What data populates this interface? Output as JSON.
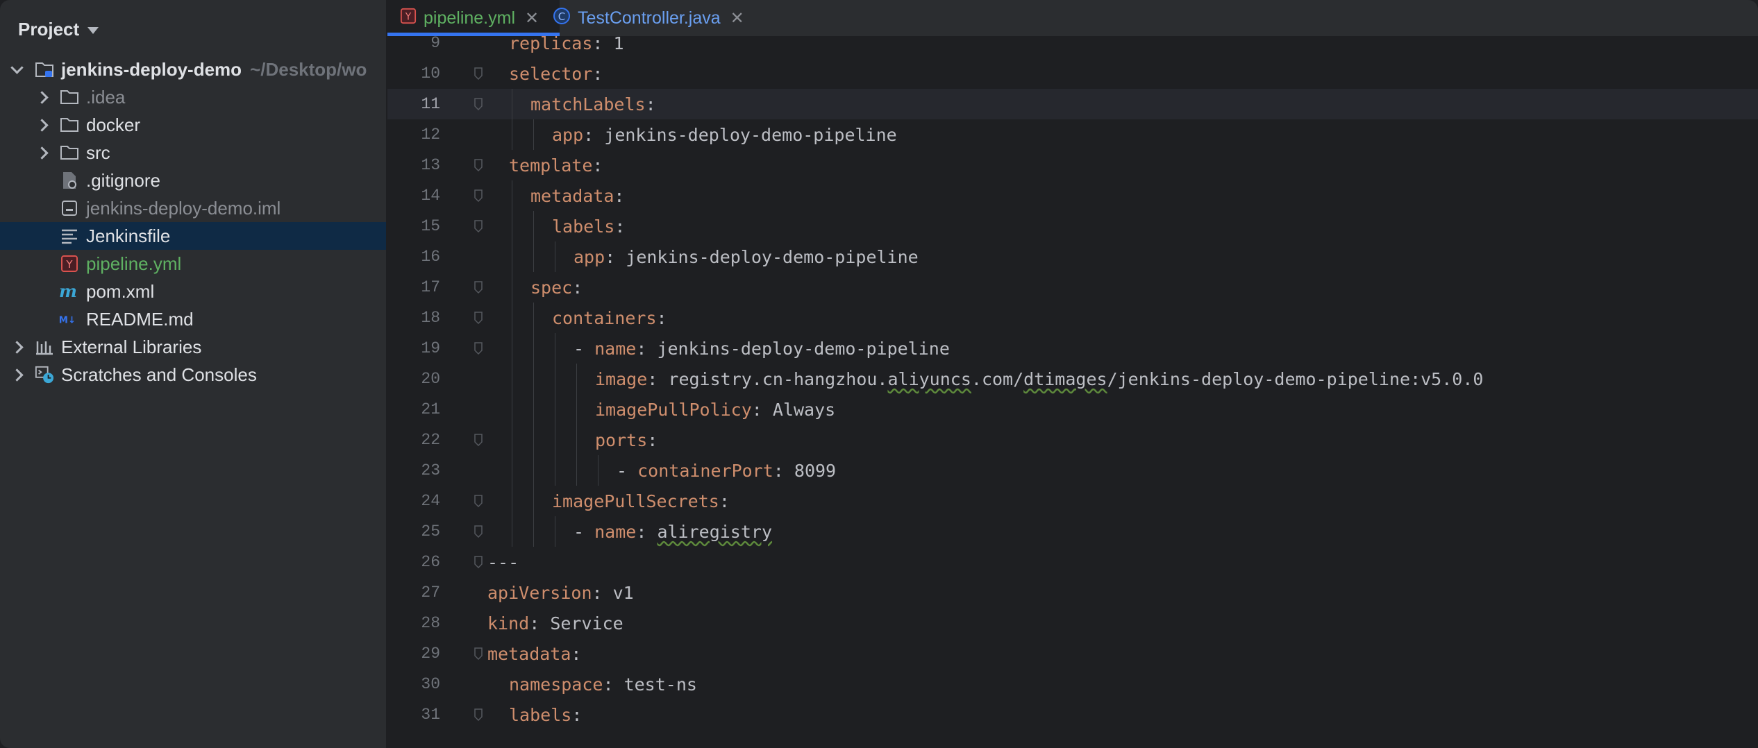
{
  "project": {
    "title": "Project",
    "tree": [
      {
        "label": "jenkins-deploy-demo",
        "path": "~/Desktop/wo",
        "icon": "module-folder-icon",
        "expanded": true
      },
      {
        "label": ".idea",
        "icon": "folder-icon"
      },
      {
        "label": "docker",
        "icon": "folder-icon"
      },
      {
        "label": "src",
        "icon": "folder-icon"
      },
      {
        "label": ".gitignore",
        "icon": "gitignore-file-icon"
      },
      {
        "label": "jenkins-deploy-demo.iml",
        "icon": "iml-file-icon"
      },
      {
        "label": "Jenkinsfile",
        "icon": "text-file-icon"
      },
      {
        "label": "pipeline.yml",
        "icon": "yaml-file-icon"
      },
      {
        "label": "pom.xml",
        "icon": "maven-file-icon"
      },
      {
        "label": "README.md",
        "icon": "markdown-file-icon"
      },
      {
        "label": "External Libraries",
        "icon": "libraries-icon"
      },
      {
        "label": "Scratches and Consoles",
        "icon": "scratches-icon"
      }
    ]
  },
  "tabs": [
    {
      "label": "pipeline.yml",
      "icon": "yaml-file-icon",
      "active": true
    },
    {
      "label": "TestController.java",
      "icon": "java-class-icon",
      "active": false
    }
  ],
  "code": [
    {
      "n": "9",
      "indent": 1,
      "k": "replicas",
      "v": "1"
    },
    {
      "n": "10",
      "indent": 1,
      "k": "selector",
      "v": ""
    },
    {
      "n": "11",
      "indent": 2,
      "k": "matchLabels",
      "v": ""
    },
    {
      "n": "12",
      "indent": 3,
      "k": "app",
      "v": "jenkins-deploy-demo-pipeline"
    },
    {
      "n": "13",
      "indent": 1,
      "k": "template",
      "v": ""
    },
    {
      "n": "14",
      "indent": 2,
      "k": "metadata",
      "v": ""
    },
    {
      "n": "15",
      "indent": 3,
      "k": "labels",
      "v": ""
    },
    {
      "n": "16",
      "indent": 4,
      "k": "app",
      "v": "jenkins-deploy-demo-pipeline"
    },
    {
      "n": "17",
      "indent": 2,
      "k": "spec",
      "v": ""
    },
    {
      "n": "18",
      "indent": 3,
      "k": "containers",
      "v": ""
    },
    {
      "n": "19",
      "indent": 4,
      "dash": true,
      "k": "name",
      "v": "jenkins-deploy-demo-pipeline"
    },
    {
      "n": "20",
      "indent": 5,
      "k": "image",
      "v": "registry.cn-hangzhou.aliyuncs.com/dtimages/jenkins-deploy-demo-pipeline:v5.0.0"
    },
    {
      "n": "21",
      "indent": 5,
      "k": "imagePullPolicy",
      "v": "Always"
    },
    {
      "n": "22",
      "indent": 5,
      "k": "ports",
      "v": ""
    },
    {
      "n": "23",
      "indent": 6,
      "dash": true,
      "k": "containerPort",
      "v": "8099"
    },
    {
      "n": "24",
      "indent": 3,
      "k": "imagePullSecrets",
      "v": ""
    },
    {
      "n": "25",
      "indent": 4,
      "dash": true,
      "k": "name",
      "v": "aliregistry"
    },
    {
      "n": "26",
      "indent": 0,
      "raw": "---"
    },
    {
      "n": "27",
      "indent": 0,
      "k": "apiVersion",
      "v": "v1"
    },
    {
      "n": "28",
      "indent": 0,
      "k": "kind",
      "v": "Service"
    },
    {
      "n": "29",
      "indent": 0,
      "k": "metadata",
      "v": ""
    },
    {
      "n": "30",
      "indent": 1,
      "k": "namespace",
      "v": "test-ns"
    },
    {
      "n": "31",
      "indent": 1,
      "k": "labels",
      "v": ""
    }
  ],
  "current_line": "11",
  "colors": {
    "key": "#cf8e6d",
    "value": "#bcbec4",
    "accent": "#3574f0",
    "selection": "#0f2a45"
  }
}
